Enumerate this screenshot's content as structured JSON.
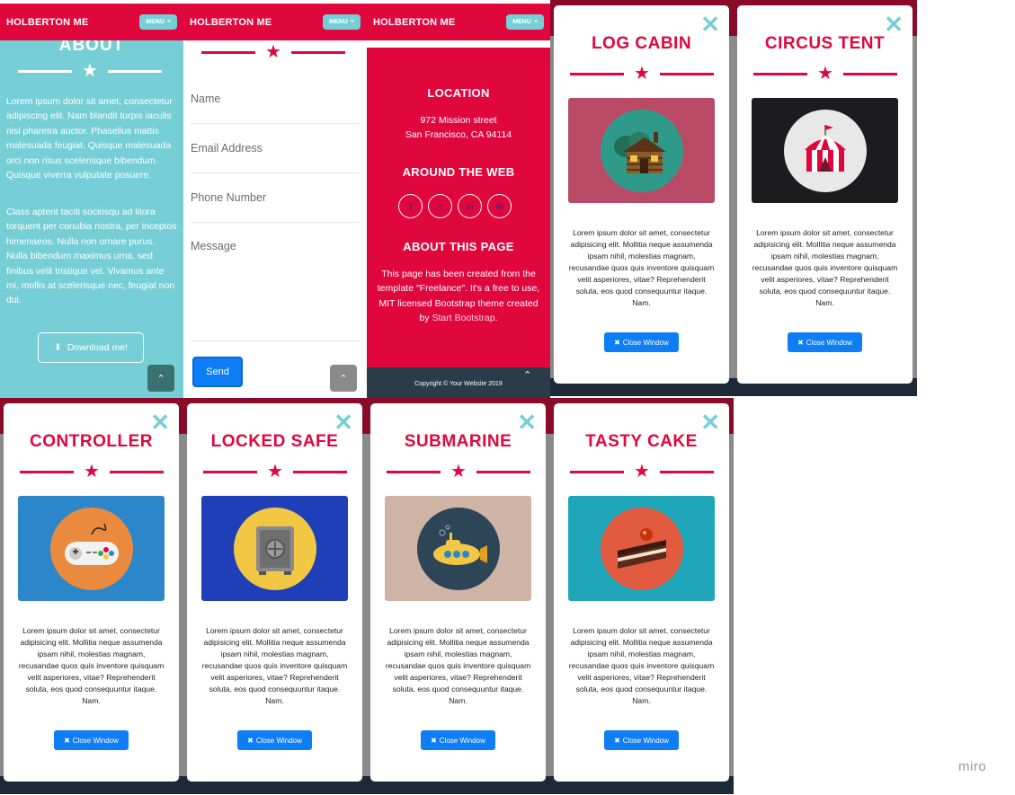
{
  "navbar": {
    "brand": "HOLBERTON ME",
    "menu_label": "MENU"
  },
  "about": {
    "title": "ABOUT",
    "paragraph1": "Lorem ipsum dolor sit amet, consectetur adipiscing elit. Nam blandit turpis iaculis nisl pharetra auctor. Phasellus mattis malesuada feugiat. Quisque malesuada orci non risus scelerisque bibendum. Quisque viverra vulputate posuere.",
    "paragraph2": "Class aptent taciti sociosqu ad litora torquent per conubia nostra, per inceptos himenaeos. Nulla non ornare purus. Nulla bibendum maximus urna, sed finibus velit tristique vel. Vivamus ante mi, mollis at scelerisque nec, feugiat non dui.",
    "download_label": "Download me!"
  },
  "contact": {
    "name_placeholder": "Name",
    "email_placeholder": "Email Address",
    "phone_placeholder": "Phone Number",
    "message_placeholder": "Message",
    "send_label": "Send"
  },
  "footer": {
    "location_title": "LOCATION",
    "address_line1": "972 Mission street",
    "address_line2": "San Francisco, CA 94114",
    "web_title": "AROUND THE WEB",
    "socials": [
      "f",
      "t",
      "in",
      "◎"
    ],
    "about_title": "ABOUT THIS PAGE",
    "about_text": "This page has been created from the template \"Freelance\". It's a free to use, MIT licensed Bootstrap theme created by",
    "about_link": "Start Bootstrap",
    "about_end": ".",
    "copyright": "Copyright © Your Website 2019"
  },
  "modal_common": {
    "description": "Lorem ipsum dolor sit amet, consectetur adipisicing elit. Mollitia neque assumenda ipsam nihil, molestias magnam, recusandae quos quis inventore quisquam velit asperiores, vitae? Reprehenderit soluta, eos quod consequuntur itaque. Nam.",
    "close_label": "Close Window"
  },
  "modals": [
    {
      "title": "LOG CABIN",
      "bg": "#b94a65",
      "circle": "#2f9a8a",
      "icon": "log-cabin"
    },
    {
      "title": "CIRCUS TENT",
      "bg": "#1c1c1e",
      "circle": "#e8e8e8",
      "icon": "circus-tent"
    },
    {
      "title": "CONTROLLER",
      "bg": "#2b87c9",
      "circle": "#e98a3f",
      "icon": "game-controller"
    },
    {
      "title": "LOCKED SAFE",
      "bg": "#1f3fb8",
      "circle": "#f2c744",
      "icon": "locked-safe"
    },
    {
      "title": "SUBMARINE",
      "bg": "#cfb3a5",
      "circle": "#2e4557",
      "icon": "submarine"
    },
    {
      "title": "TASTY CAKE",
      "bg": "#1fa6b8",
      "circle": "#e25a3f",
      "icon": "cake"
    }
  ],
  "watermark": "miro"
}
